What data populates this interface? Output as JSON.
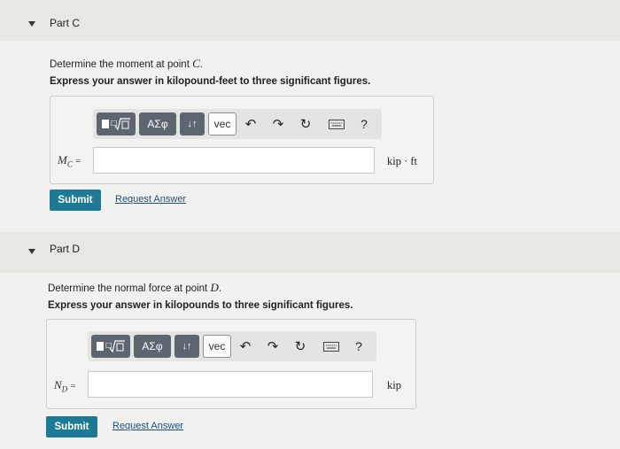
{
  "parts": [
    {
      "title": "Part C",
      "prompt_text": "Determine the moment at point ",
      "prompt_var": "C",
      "instruction": "Express your answer in kilopound-feet to three significant figures.",
      "label": "M",
      "label_sub": "C",
      "equals": "=",
      "unit": "kip · ft",
      "input_value": "",
      "submit_label": "Submit",
      "request_label": "Request Answer"
    },
    {
      "title": "Part D",
      "prompt_text": "Determine the normal force at point ",
      "prompt_var": "D",
      "instruction": "Express your answer in kilopounds to three significant figures.",
      "label": "N",
      "label_sub": "D",
      "equals": "=",
      "unit": "kip",
      "input_value": "",
      "submit_label": "Submit",
      "request_label": "Request Answer"
    }
  ],
  "toolbar": {
    "greek_label": "ΑΣφ",
    "vec_label": "vec",
    "help_label": "?"
  },
  "colors": {
    "submit_bg": "#1e7a94",
    "toolbar_btn_bg": "#5d6670"
  }
}
